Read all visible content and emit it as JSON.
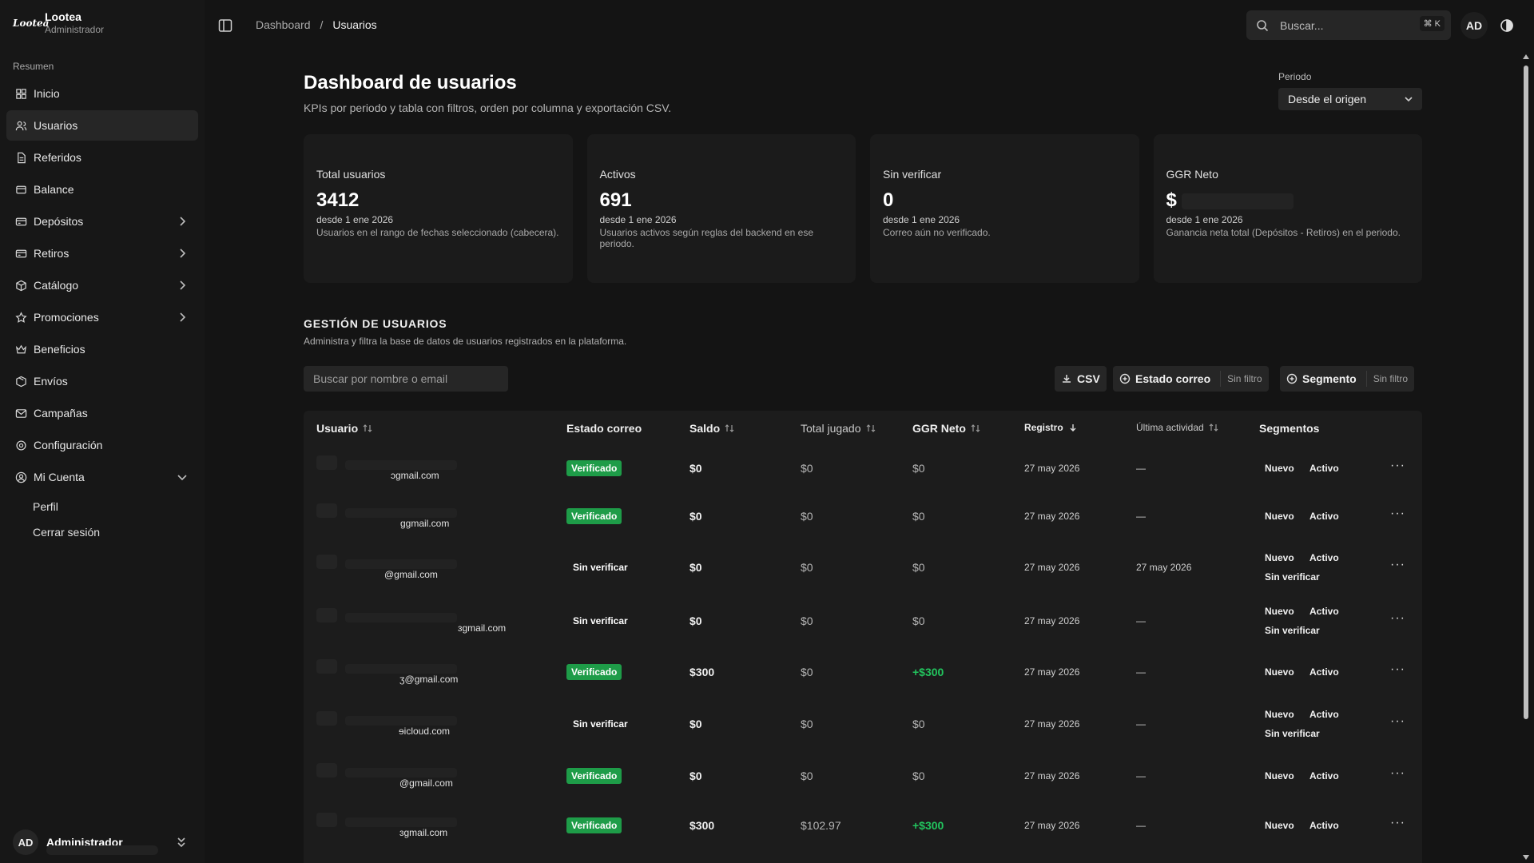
{
  "brand": {
    "name": "Lootea",
    "role": "Administrador",
    "logo_text": "Lootea"
  },
  "sidebar": {
    "section_label": "Resumen",
    "items": [
      {
        "label": "Inicio",
        "icon": "grid-icon"
      },
      {
        "label": "Usuarios",
        "icon": "users-icon",
        "active": true
      },
      {
        "label": "Referidos",
        "icon": "document-icon"
      },
      {
        "label": "Balance",
        "icon": "wallet-icon"
      },
      {
        "label": "Depósitos",
        "icon": "card-icon",
        "expandable": true
      },
      {
        "label": "Retiros",
        "icon": "card-icon",
        "expandable": true
      },
      {
        "label": "Catálogo",
        "icon": "box-icon",
        "expandable": true
      },
      {
        "label": "Promociones",
        "icon": "star-icon",
        "expandable": true
      },
      {
        "label": "Beneficios",
        "icon": "crown-icon"
      },
      {
        "label": "Envíos",
        "icon": "package-icon"
      },
      {
        "label": "Campañas",
        "icon": "mail-icon"
      },
      {
        "label": "Configuración",
        "icon": "gear-icon"
      },
      {
        "label": "Mi Cuenta",
        "icon": "user-circle-icon",
        "expanded": true
      }
    ],
    "subitems": [
      "Perfil",
      "Cerrar sesión"
    ],
    "footer": {
      "initials": "AD",
      "name": "Administrador"
    }
  },
  "topbar": {
    "breadcrumb": [
      "Dashboard",
      "Usuarios"
    ],
    "breadcrumb_sep": "/",
    "search_placeholder": "Buscar...",
    "shortcut": "⌘ K",
    "avatar_initials": "AD"
  },
  "header": {
    "title": "Dashboard de usuarios",
    "subtitle": "KPIs por periodo y tabla con filtros, orden por columna y exportación CSV.",
    "period_label": "Periodo",
    "period_value": "Desde el origen"
  },
  "kpis": [
    {
      "label": "Total usuarios",
      "value": "3412",
      "date": "desde 1 ene 2026",
      "desc": "Usuarios en el rango de fechas seleccionado (cabecera)."
    },
    {
      "label": "Activos",
      "value": "691",
      "date": "desde 1 ene 2026",
      "desc": "Usuarios activos según reglas del backend en ese periodo."
    },
    {
      "label": "Sin verificar",
      "value": "0",
      "date": "desde 1 ene 2026",
      "desc": "Correo aún no verificado."
    },
    {
      "label": "GGR Neto",
      "value": "$",
      "date": "desde 1 ene 2026",
      "desc": "Ganancia neta total (Depósitos - Retiros) en el periodo."
    }
  ],
  "section": {
    "title": "GESTIÓN DE USUARIOS",
    "subtitle": "Administra y filtra la base de datos de usuarios registrados en la plataforma.",
    "search_placeholder": "Buscar por nombre o email",
    "csv_label": "CSV",
    "estado_label": "Estado correo",
    "estado_filter": "Sin filtro",
    "segmento_label": "Segmento",
    "segmento_filter": "Sin filtro"
  },
  "table": {
    "headers": {
      "usuario": "Usuario",
      "estado": "Estado correo",
      "saldo": "Saldo",
      "jugado": "Total jugado",
      "ggr": "GGR Neto",
      "registro": "Registro",
      "actividad": "Última actividad",
      "segmentos": "Segmentos"
    },
    "rows": [
      {
        "email": "ɔgmail.com",
        "estado": "Verificado",
        "verified": true,
        "saldo": "$0",
        "jugado": "$0",
        "ggr": "$0",
        "ggr_pos": false,
        "registro": "27 may 2026",
        "actividad": "—",
        "seg": [
          "Nuevo",
          "Activo"
        ],
        "seg2": ""
      },
      {
        "email": "ɡgmail.com",
        "estado": "Verificado",
        "verified": true,
        "saldo": "$0",
        "jugado": "$0",
        "ggr": "$0",
        "ggr_pos": false,
        "registro": "27 may 2026",
        "actividad": "—",
        "seg": [
          "Nuevo",
          "Activo"
        ],
        "seg2": ""
      },
      {
        "email": "@gmail.com",
        "estado": "Sin verificar",
        "verified": false,
        "saldo": "$0",
        "jugado": "$0",
        "ggr": "$0",
        "ggr_pos": false,
        "registro": "27 may 2026",
        "actividad": "27 may 2026",
        "seg": [
          "Nuevo",
          "Activo"
        ],
        "seg2": "Sin verificar"
      },
      {
        "email": "ɜgmail.com",
        "estado": "Sin verificar",
        "verified": false,
        "saldo": "$0",
        "jugado": "$0",
        "ggr": "$0",
        "ggr_pos": false,
        "registro": "27 may 2026",
        "actividad": "—",
        "seg": [
          "Nuevo",
          "Activo"
        ],
        "seg2": "Sin verificar"
      },
      {
        "email": "ʒ@gmail.com",
        "estado": "Verificado",
        "verified": true,
        "saldo": "$300",
        "jugado": "$0",
        "ggr": "+$300",
        "ggr_pos": true,
        "registro": "27 may 2026",
        "actividad": "—",
        "seg": [
          "Nuevo",
          "Activo"
        ],
        "seg2": ""
      },
      {
        "email": "ɘicloud.com",
        "estado": "Sin verificar",
        "verified": false,
        "saldo": "$0",
        "jugado": "$0",
        "ggr": "$0",
        "ggr_pos": false,
        "registro": "27 may 2026",
        "actividad": "—",
        "seg": [
          "Nuevo",
          "Activo"
        ],
        "seg2": "Sin verificar"
      },
      {
        "email": "@gmail.com",
        "estado": "Verificado",
        "verified": true,
        "saldo": "$0",
        "jugado": "$0",
        "ggr": "$0",
        "ggr_pos": false,
        "registro": "27 may 2026",
        "actividad": "—",
        "seg": [
          "Nuevo",
          "Activo"
        ],
        "seg2": ""
      },
      {
        "email": "ɜgmail.com",
        "estado": "Verificado",
        "verified": true,
        "saldo": "$300",
        "jugado": "$102.97",
        "ggr": "+$300",
        "ggr_pos": true,
        "registro": "27 may 2026",
        "actividad": "—",
        "seg": [
          "Nuevo",
          "Activo"
        ],
        "seg2": ""
      }
    ],
    "more_icon": "more-horizontal-icon"
  },
  "colors": {
    "background": "#141414",
    "sidebar": "#171717",
    "card": "#1b1b1b",
    "verified_badge": "#1e9c48",
    "positive": "#22c55e"
  }
}
